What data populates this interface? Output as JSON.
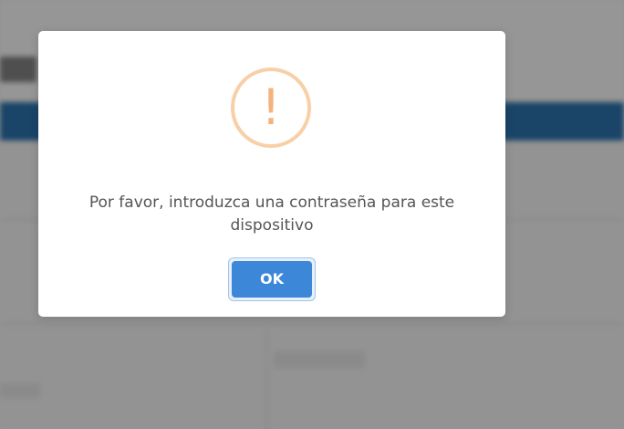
{
  "dialog": {
    "icon": "exclamation-warning-icon",
    "icon_glyph": "!",
    "message": "Por favor, introduzca una contraseña para este dispositivo",
    "ok_label": "OK"
  },
  "colors": {
    "overlay": "rgba(0,0,0,0.38)",
    "warning_ring": "#f8cfa6",
    "warning_glyph": "#f5b27f",
    "button": "#3c87d7",
    "background_bar": "#2a6fa8"
  }
}
